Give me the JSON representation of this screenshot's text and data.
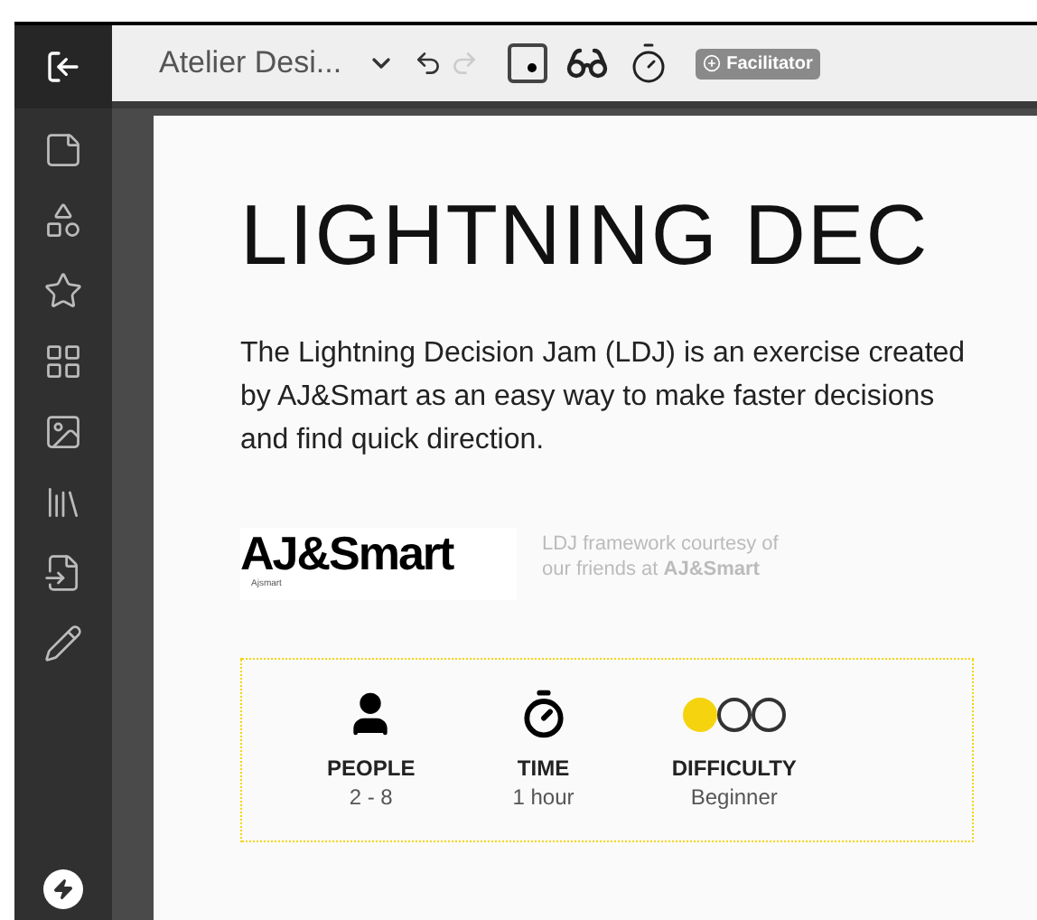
{
  "toolbar": {
    "board_name": "Atelier Desi...",
    "badge": "Facilitator"
  },
  "page": {
    "title": "LIGHTNING DEC",
    "intro": "The Lightning Decision Jam (LDJ) is an exercise created by AJ&Smart as an easy way to make faster decisions and find quick direction.",
    "logo": {
      "name": "AJ&Smart",
      "caption": "Ajsmart"
    },
    "credit": "LDJ framework courtesy of our friends at **AJ&Smart**",
    "facts": [
      {
        "kind": "people",
        "label": "PEOPLE",
        "value": "2 - 8"
      },
      {
        "kind": "time",
        "label": "TIME",
        "value": "1 hour"
      },
      {
        "kind": "difficulty",
        "label": "DIFFICULTY",
        "value": "Beginner",
        "stars": 1
      }
    ]
  }
}
